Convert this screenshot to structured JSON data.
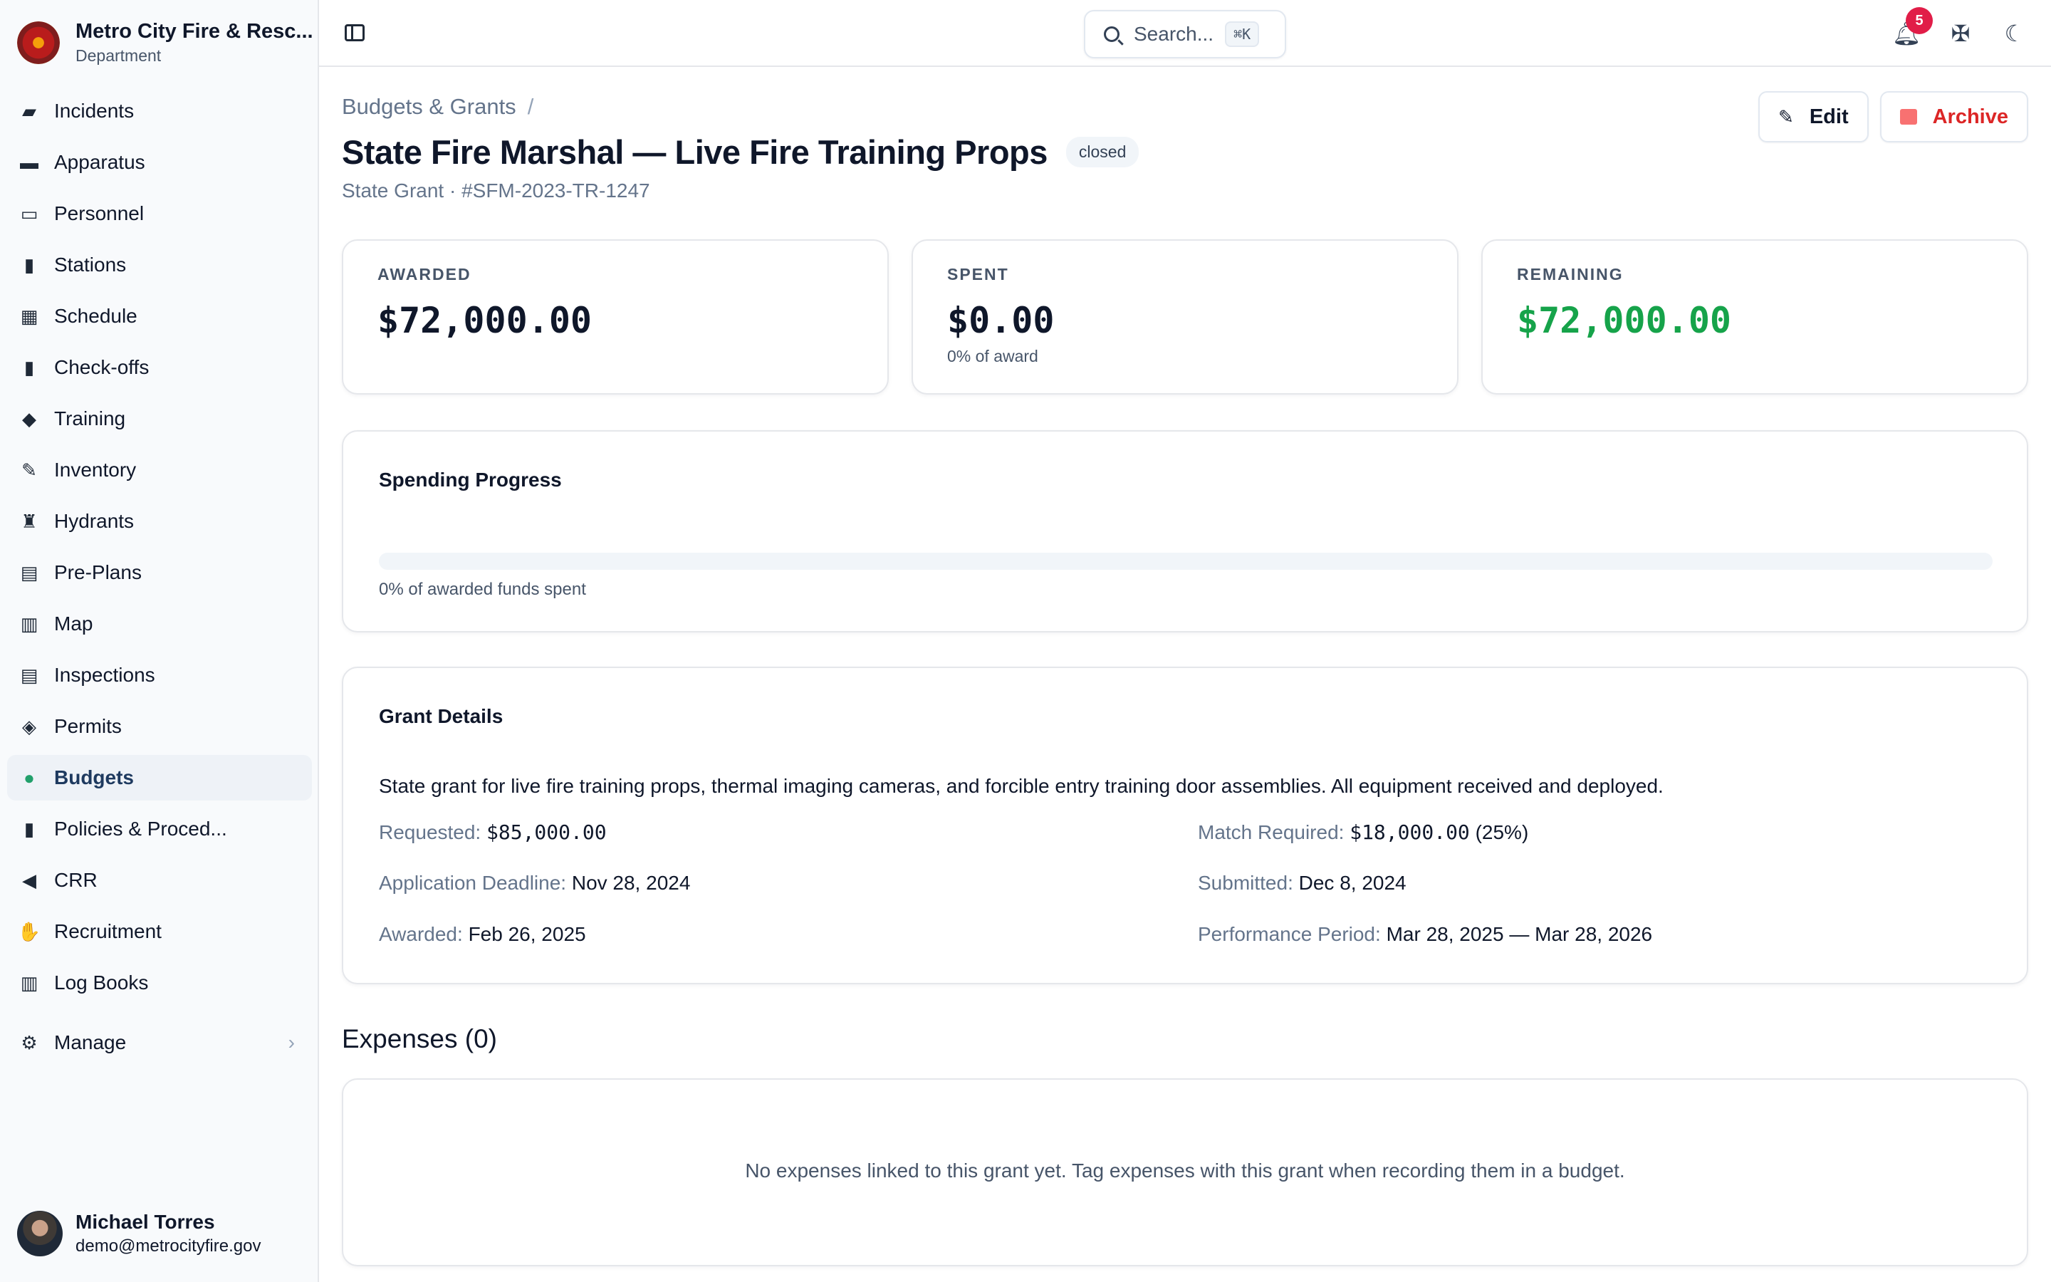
{
  "org": {
    "name": "Metro City Fire & Resc...",
    "subtitle": "Department"
  },
  "nav": {
    "items": [
      {
        "label": "Incidents",
        "icon": "incidents-icon"
      },
      {
        "label": "Apparatus",
        "icon": "truck-icon"
      },
      {
        "label": "Personnel",
        "icon": "id-card-icon"
      },
      {
        "label": "Stations",
        "icon": "building-icon"
      },
      {
        "label": "Schedule",
        "icon": "calendar-icon"
      },
      {
        "label": "Check-offs",
        "icon": "clipboard-check-icon"
      },
      {
        "label": "Training",
        "icon": "graduation-cap-icon"
      },
      {
        "label": "Inventory",
        "icon": "wrench-icon"
      },
      {
        "label": "Hydrants",
        "icon": "hydrant-icon"
      },
      {
        "label": "Pre-Plans",
        "icon": "building-shield-icon"
      },
      {
        "label": "Map",
        "icon": "map-icon"
      },
      {
        "label": "Inspections",
        "icon": "clipboard-icon"
      },
      {
        "label": "Permits",
        "icon": "permit-icon"
      },
      {
        "label": "Budgets",
        "icon": "money-bag-icon",
        "active": true
      },
      {
        "label": "Policies & Proced...",
        "icon": "book-icon"
      },
      {
        "label": "CRR",
        "icon": "megaphone-icon"
      },
      {
        "label": "Recruitment",
        "icon": "handshake-icon"
      },
      {
        "label": "Log Books",
        "icon": "books-icon"
      }
    ],
    "manage": "Manage"
  },
  "user": {
    "name": "Michael Torres",
    "email": "demo@metrocityfire.gov"
  },
  "topbar": {
    "search_placeholder": "Search...",
    "search_shortcut": "⌘K",
    "notification_count": "5"
  },
  "page": {
    "breadcrumb": "Budgets & Grants",
    "breadcrumb_sep": "/",
    "title": "State Fire Marshal — Live Fire Training Props",
    "status": "closed",
    "subtitle": "State Grant · #SFM-2023-TR-1247",
    "edit_label": "Edit",
    "archive_label": "Archive"
  },
  "stats": {
    "awarded": {
      "label": "AWARDED",
      "value": "$72,000.00"
    },
    "spent": {
      "label": "SPENT",
      "value": "$0.00",
      "sub": "0% of award"
    },
    "remaining": {
      "label": "REMAINING",
      "value": "$72,000.00"
    }
  },
  "progress": {
    "title": "Spending Progress",
    "percent": 0,
    "caption": "0% of awarded funds spent"
  },
  "details": {
    "title": "Grant Details",
    "description": "State grant for live fire training props, thermal imaging cameras, and forcible entry training door assemblies. All equipment received and deployed.",
    "requested_label": "Requested:",
    "requested_value": "$85,000.00",
    "match_label": "Match Required:",
    "match_value": "$18,000.00",
    "match_pct": "(25%)",
    "deadline_label": "Application Deadline:",
    "deadline_value": "Nov 28, 2024",
    "submitted_label": "Submitted:",
    "submitted_value": "Dec 8, 2024",
    "awarded_label": "Awarded:",
    "awarded_value": "Feb 26, 2025",
    "period_label": "Performance Period:",
    "period_value": "Mar 28, 2025 — Mar 28, 2026"
  },
  "expenses": {
    "title": "Expenses (0)",
    "empty": "No expenses linked to this grant yet. Tag expenses with this grant when recording them in a budget."
  },
  "colors": {
    "accent_green": "#16a34a",
    "danger": "#dc2626",
    "badge": "#e11d48"
  }
}
